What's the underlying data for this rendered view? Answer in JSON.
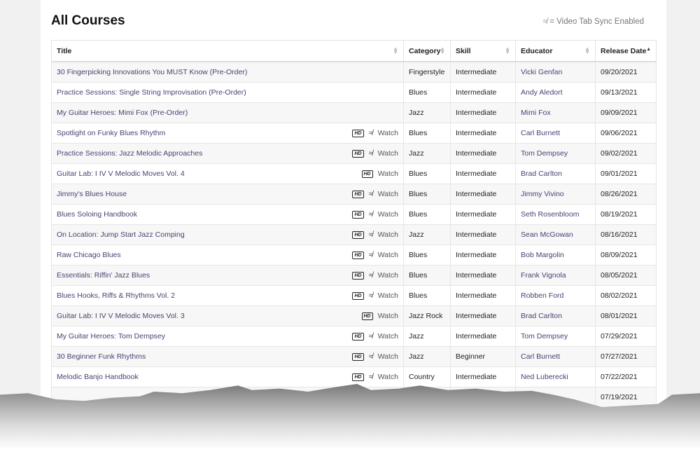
{
  "page_title": "All Courses",
  "legend": {
    "icon": "sync-icon",
    "text": "= Video Tab Sync Enabled"
  },
  "columns": [
    "Title",
    "Category",
    "Skill",
    "Educator",
    "Release Date"
  ],
  "sorted_column": "Release Date",
  "watch_label": "Watch",
  "hd_label": "HD",
  "rows": [
    {
      "title": "30 Fingerpicking Innovations You MUST Know (Pre-Order)",
      "hd": false,
      "sync": false,
      "watch": false,
      "category": "Fingerstyle",
      "skill": "Intermediate",
      "educator": "Vicki Genfan",
      "date": "09/20/2021"
    },
    {
      "title": "Practice Sessions: Single String Improvisation (Pre-Order)",
      "hd": false,
      "sync": false,
      "watch": false,
      "category": "Blues",
      "skill": "Intermediate",
      "educator": "Andy Aledort",
      "date": "09/13/2021"
    },
    {
      "title": "My Guitar Heroes: Mimi Fox (Pre-Order)",
      "hd": false,
      "sync": false,
      "watch": false,
      "category": "Jazz",
      "skill": "Intermediate",
      "educator": "Mimi Fox",
      "date": "09/09/2021"
    },
    {
      "title": "Spotlight on Funky Blues Rhythm",
      "hd": true,
      "sync": true,
      "watch": true,
      "category": "Blues",
      "skill": "Intermediate",
      "educator": "Carl Burnett",
      "date": "09/06/2021"
    },
    {
      "title": "Practice Sessions: Jazz Melodic Approaches",
      "hd": true,
      "sync": true,
      "watch": true,
      "category": "Jazz",
      "skill": "Intermediate",
      "educator": "Tom Dempsey",
      "date": "09/02/2021"
    },
    {
      "title": "Guitar Lab: I IV V Melodic Moves Vol. 4",
      "hd": true,
      "sync": false,
      "watch": true,
      "category": "Blues",
      "skill": "Intermediate",
      "educator": "Brad Carlton",
      "date": "09/01/2021"
    },
    {
      "title": "Jimmy's Blues House",
      "hd": true,
      "sync": true,
      "watch": true,
      "category": "Blues",
      "skill": "Intermediate",
      "educator": "Jimmy Vivino",
      "date": "08/26/2021"
    },
    {
      "title": "Blues Soloing Handbook",
      "hd": true,
      "sync": true,
      "watch": true,
      "category": "Blues",
      "skill": "Intermediate",
      "educator": "Seth Rosenbloom",
      "date": "08/19/2021"
    },
    {
      "title": "On Location: Jump Start Jazz Comping",
      "hd": true,
      "sync": true,
      "watch": true,
      "category": "Jazz",
      "skill": "Intermediate",
      "educator": "Sean McGowan",
      "date": "08/16/2021"
    },
    {
      "title": "Raw Chicago Blues",
      "hd": true,
      "sync": true,
      "watch": true,
      "category": "Blues",
      "skill": "Intermediate",
      "educator": "Bob Margolin",
      "date": "08/09/2021"
    },
    {
      "title": "Essentials: Riffin' Jazz Blues",
      "hd": true,
      "sync": true,
      "watch": true,
      "category": "Blues",
      "skill": "Intermediate",
      "educator": "Frank Vignola",
      "date": "08/05/2021"
    },
    {
      "title": "Blues Hooks, Riffs & Rhythms Vol. 2",
      "hd": true,
      "sync": true,
      "watch": true,
      "category": "Blues",
      "skill": "Intermediate",
      "educator": "Robben Ford",
      "date": "08/02/2021"
    },
    {
      "title": "Guitar Lab: I IV V Melodic Moves Vol. 3",
      "hd": true,
      "sync": false,
      "watch": true,
      "category": "Jazz Rock",
      "skill": "Intermediate",
      "educator": "Brad Carlton",
      "date": "08/01/2021"
    },
    {
      "title": "My Guitar Heroes: Tom Dempsey",
      "hd": true,
      "sync": true,
      "watch": true,
      "category": "Jazz",
      "skill": "Intermediate",
      "educator": "Tom Dempsey",
      "date": "07/29/2021"
    },
    {
      "title": "30 Beginner Funk Rhythms",
      "hd": true,
      "sync": true,
      "watch": true,
      "category": "Jazz",
      "skill": "Beginner",
      "educator": "Carl Burnett",
      "date": "07/27/2021"
    },
    {
      "title": "Melodic Banjo Handbook",
      "hd": true,
      "sync": true,
      "watch": true,
      "category": "Country",
      "skill": "Intermediate",
      "educator": "Ned Luberecki",
      "date": "07/22/2021"
    },
    {
      "title": "",
      "hd": false,
      "sync": false,
      "watch": false,
      "category": "",
      "skill": "",
      "educator": "",
      "date": "07/19/2021"
    }
  ]
}
